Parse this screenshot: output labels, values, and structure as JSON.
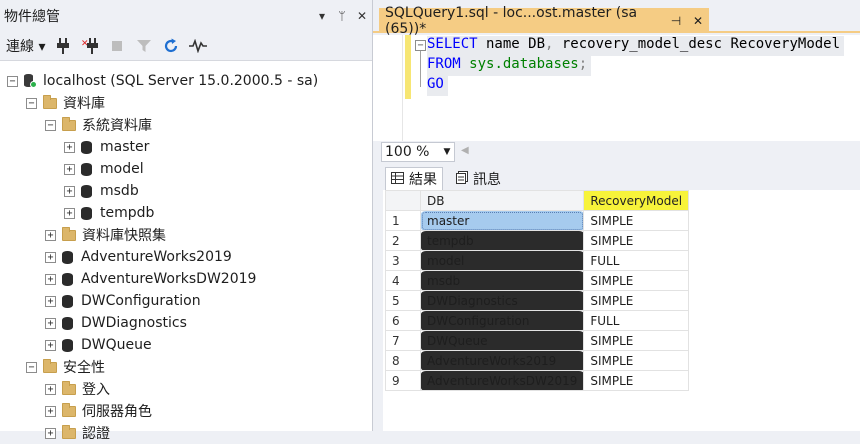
{
  "object_explorer": {
    "title": "物件總管",
    "title_buttons": [
      "▾",
      "ᛘ",
      "✕"
    ],
    "toolbar": {
      "connect_label": "連線 ▾"
    },
    "tree": [
      {
        "level": 0,
        "exp": "⊟",
        "icon": "server",
        "label": "localhost (SQL Server 15.0.2000.5 - sa)"
      },
      {
        "level": 1,
        "exp": "⊟",
        "icon": "folder",
        "label": "資料庫"
      },
      {
        "level": 2,
        "exp": "⊟",
        "icon": "folder",
        "label": "系統資料庫"
      },
      {
        "level": 3,
        "exp": "⊞",
        "icon": "db",
        "label": "master"
      },
      {
        "level": 3,
        "exp": "⊞",
        "icon": "db",
        "label": "model"
      },
      {
        "level": 3,
        "exp": "⊞",
        "icon": "db",
        "label": "msdb"
      },
      {
        "level": 3,
        "exp": "⊞",
        "icon": "db",
        "label": "tempdb"
      },
      {
        "level": 2,
        "exp": "⊞",
        "icon": "folder",
        "label": "資料庫快照集"
      },
      {
        "level": 2,
        "exp": "⊞",
        "icon": "db",
        "label": "AdventureWorks2019"
      },
      {
        "level": 2,
        "exp": "⊞",
        "icon": "db",
        "label": "AdventureWorksDW2019"
      },
      {
        "level": 2,
        "exp": "⊞",
        "icon": "db",
        "label": "DWConfiguration"
      },
      {
        "level": 2,
        "exp": "⊞",
        "icon": "db",
        "label": "DWDiagnostics"
      },
      {
        "level": 2,
        "exp": "⊞",
        "icon": "db",
        "label": "DWQueue"
      },
      {
        "level": 1,
        "exp": "⊟",
        "icon": "folder",
        "label": "安全性"
      },
      {
        "level": 2,
        "exp": "⊞",
        "icon": "folder",
        "label": "登入"
      },
      {
        "level": 2,
        "exp": "⊞",
        "icon": "folder",
        "label": "伺服器角色"
      },
      {
        "level": 2,
        "exp": "⊞",
        "icon": "folder",
        "label": "認證"
      }
    ]
  },
  "query_tab": {
    "title": "SQLQuery1.sql - loc...ost.master (sa (65))*",
    "pin": "⊣",
    "close": "✕"
  },
  "editor": {
    "collapse": "−",
    "lines": [
      [
        {
          "t": "SELECT",
          "c": "kw"
        },
        {
          "t": " name DB",
          "c": "plain"
        },
        {
          "t": ",",
          "c": "sym"
        },
        {
          "t": " recovery_model_desc RecoveryModel",
          "c": "plain"
        }
      ],
      [
        {
          "t": "FROM",
          "c": "kw"
        },
        {
          "t": " ",
          "c": "plain"
        },
        {
          "t": "sys.databases",
          "c": "fn"
        },
        {
          "t": ";",
          "c": "sym"
        }
      ],
      [
        {
          "t": "GO",
          "c": "kw"
        }
      ]
    ]
  },
  "zoom": {
    "value": "100 %"
  },
  "results_tabs": {
    "results_label": "結果",
    "messages_label": "訊息"
  },
  "grid": {
    "columns": [
      "DB",
      "RecoveryModel"
    ],
    "rows": [
      [
        "1",
        "master",
        "SIMPLE"
      ],
      [
        "2",
        "tempdb",
        "SIMPLE"
      ],
      [
        "3",
        "model",
        "FULL"
      ],
      [
        "4",
        "msdb",
        "SIMPLE"
      ],
      [
        "5",
        "DWDiagnostics",
        "SIMPLE"
      ],
      [
        "6",
        "DWConfiguration",
        "FULL"
      ],
      [
        "7",
        "DWQueue",
        "SIMPLE"
      ],
      [
        "8",
        "AdventureWorks2019",
        "SIMPLE"
      ],
      [
        "9",
        "AdventureWorksDW2019",
        "SIMPLE"
      ]
    ],
    "selected_row": 0,
    "highlight_color": "#f7f33a"
  },
  "colors": {
    "active_tab": "#f5cc84",
    "selection": "#a6cbee",
    "keyword": "#0000ff",
    "object": "#008000"
  }
}
